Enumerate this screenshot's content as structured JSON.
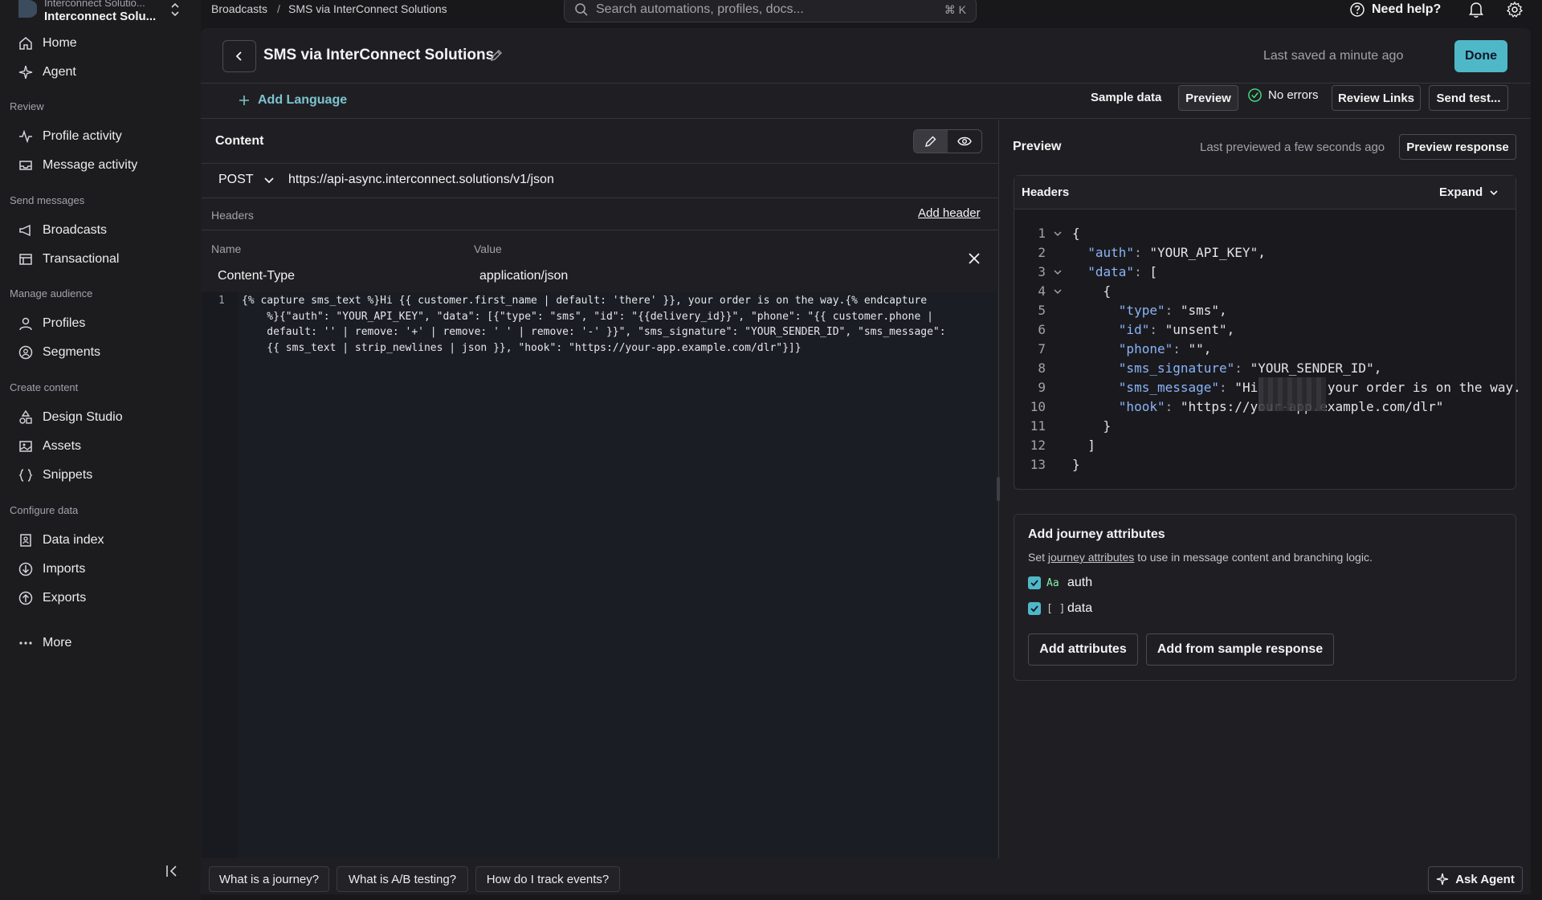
{
  "workspace": {
    "org": "Interconnect Solutio...",
    "name": "Interconnect Solu..."
  },
  "sidebar": {
    "home": "Home",
    "agent": "Agent",
    "sections": {
      "review": "Review",
      "send": "Send messages",
      "audience": "Manage audience",
      "create": "Create content",
      "data": "Configure data"
    },
    "items": {
      "profile_activity": "Profile activity",
      "message_activity": "Message activity",
      "broadcasts": "Broadcasts",
      "transactional": "Transactional",
      "profiles": "Profiles",
      "segments": "Segments",
      "design_studio": "Design Studio",
      "assets": "Assets",
      "snippets": "Snippets",
      "data_index": "Data index",
      "imports": "Imports",
      "exports": "Exports",
      "more": "More"
    }
  },
  "breadcrumb": {
    "parent": "Broadcasts",
    "sep": "/",
    "current": "SMS via InterConnect Solutions"
  },
  "search": {
    "placeholder": "Search automations, profiles, docs...",
    "shortcut": "⌘ K"
  },
  "topbar": {
    "help": "Need help?"
  },
  "header": {
    "title": "SMS via InterConnect Solutions",
    "saved": "Last saved a minute ago",
    "done": "Done"
  },
  "toolbar": {
    "add_language": "Add Language",
    "sample_data": "Sample data",
    "preview": "Preview",
    "no_errors": "No errors",
    "review_links": "Review Links",
    "send_test": "Send test..."
  },
  "editor": {
    "title": "Content",
    "method": "POST",
    "url": "https://api-async.interconnect.solutions/v1/json",
    "headers_label": "Headers",
    "add_header": "Add header",
    "col_name": "Name",
    "col_value": "Value",
    "header_rows": [
      {
        "name": "Content-Type",
        "value": "application/json"
      }
    ],
    "code_line_number": "1",
    "code_lines": [
      "{% capture sms_text %}Hi {{ customer.first_name | default: 'there' }}, your order is on the way.{% endcapture",
      "    %}{\"auth\": \"YOUR_API_KEY\", \"data\": [{\"type\": \"sms\", \"id\": \"{{delivery_id}}\", \"phone\": \"{{ customer.phone |",
      "    default: '' | remove: '+' | remove: ' ' | remove: '-' }}\", \"sms_signature\": \"YOUR_SENDER_ID\", \"sms_message\":",
      "    {{ sms_text | strip_newlines | json }}, \"hook\": \"https://your-app.example.com/dlr\"}]}"
    ]
  },
  "preview": {
    "title": "Preview",
    "last_previewed": "Last previewed a few seconds ago",
    "preview_response": "Preview response",
    "headers_title": "Headers",
    "expand": "Expand",
    "json_lines": [
      {
        "n": "1",
        "text": "{"
      },
      {
        "n": "2",
        "text": "  \"auth\": \"YOUR_API_KEY\","
      },
      {
        "n": "3",
        "text": "  \"data\": ["
      },
      {
        "n": "4",
        "text": "    {"
      },
      {
        "n": "5",
        "text": "      \"type\": \"sms\","
      },
      {
        "n": "6",
        "text": "      \"id\": \"unsent\","
      },
      {
        "n": "7",
        "text": "      \"phone\": \"\","
      },
      {
        "n": "8",
        "text": "      \"sms_signature\": \"YOUR_SENDER_ID\","
      },
      {
        "n": "9",
        "text": "      \"sms_message\": \"Hi         your order is on the way."
      },
      {
        "n": "10",
        "text": "      \"hook\": \"https://your-app.example.com/dlr\""
      },
      {
        "n": "11",
        "text": "    }"
      },
      {
        "n": "12",
        "text": "  ]"
      },
      {
        "n": "13",
        "text": "}"
      }
    ]
  },
  "attributes": {
    "title": "Add journey attributes",
    "desc_prefix": "Set",
    "desc_link": "journey attributes",
    "desc_suffix": "to use in message content and branching logic.",
    "items": [
      {
        "type": "Aa",
        "name": "auth"
      },
      {
        "type": "[ ]",
        "name": "data"
      }
    ],
    "add_attributes": "Add attributes",
    "add_from_sample": "Add from sample response"
  },
  "bottom": {
    "chips": [
      "What is a journey?",
      "What is A/B testing?",
      "How do I track events?"
    ],
    "ask_agent": "Ask Agent"
  },
  "colors": {
    "accent": "#4fb8c8",
    "link": "#7cc4cf",
    "background": "#18181b"
  }
}
